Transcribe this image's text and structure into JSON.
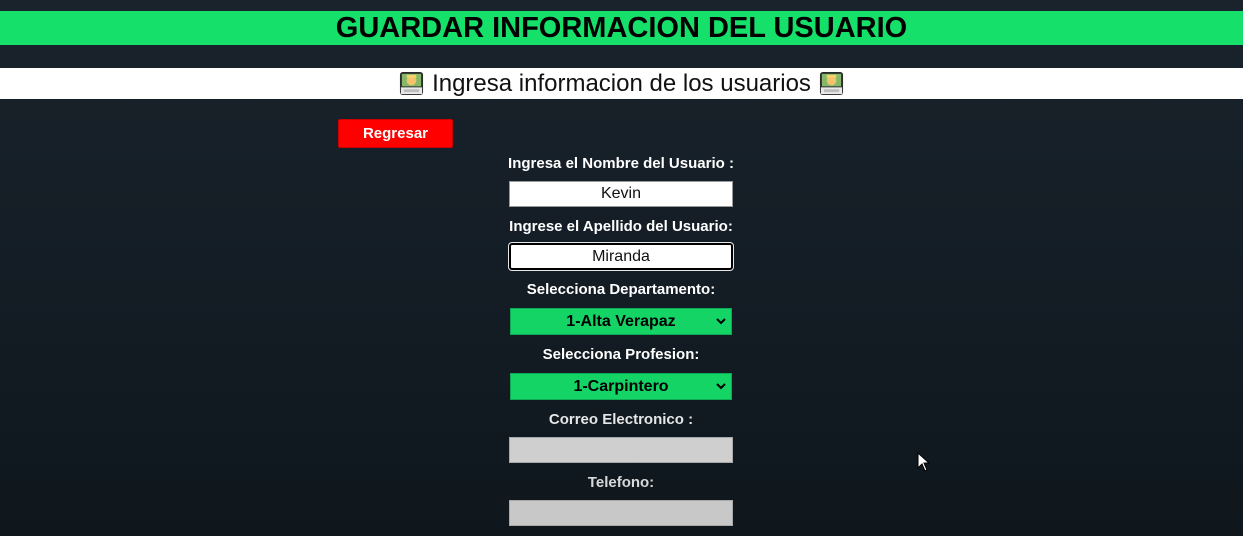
{
  "header": {
    "title": "GUARDAR INFORMACION DEL USUARIO",
    "subtitle": "Ingresa informacion de los usuarios"
  },
  "buttons": {
    "back_label": "Regresar"
  },
  "form": {
    "first_name": {
      "label": "Ingresa el Nombre del Usuario :",
      "value": "Kevin"
    },
    "last_name": {
      "label": "Ingrese el Apellido del Usuario:",
      "value": "Miranda"
    },
    "department": {
      "label": "Selecciona Departamento:",
      "selected": "1-Alta Verapaz"
    },
    "profession": {
      "label": "Selecciona Profesion:",
      "selected": "1-Carpintero"
    },
    "email": {
      "label": "Correo Electronico :",
      "value": ""
    },
    "phone": {
      "label": "Telefono:",
      "value": ""
    }
  },
  "icons": {
    "subtitle_left": "technologist-emoji-icon",
    "subtitle_right": "technologist-emoji-icon",
    "select_arrow": "chevron-down-icon",
    "pointer": "mouse-cursor-icon"
  },
  "colors": {
    "background": "#151e26",
    "accent_green": "#14e06a",
    "back_button": "#ff0000"
  }
}
